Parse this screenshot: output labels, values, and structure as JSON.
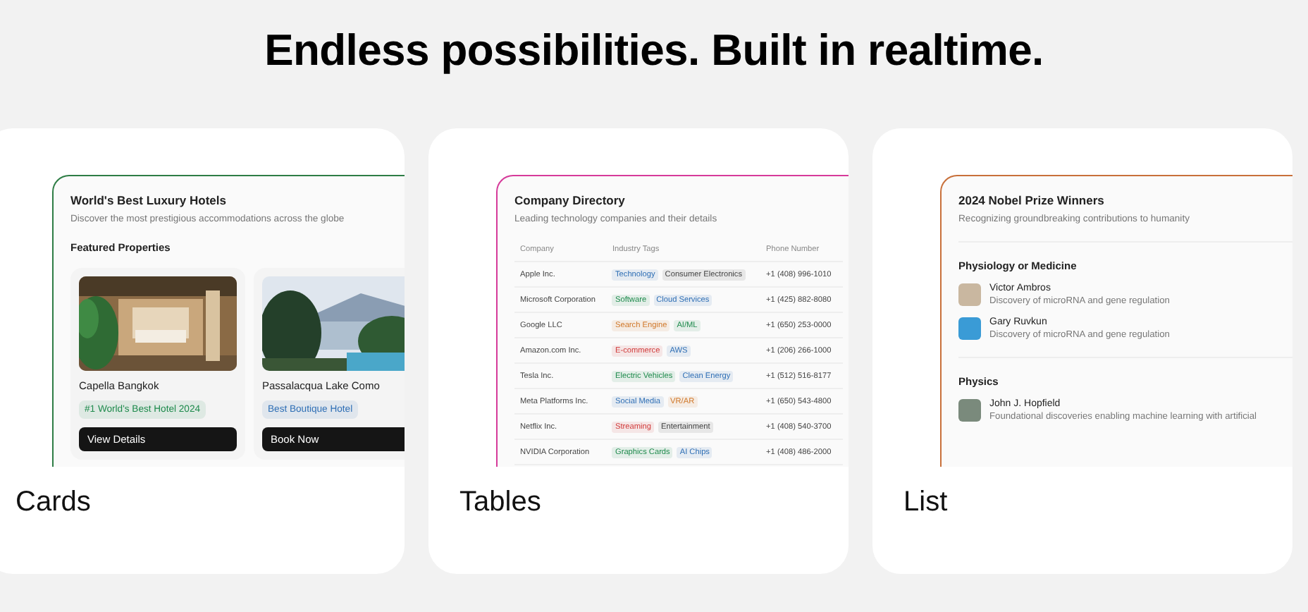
{
  "heading": "Endless possibilities. Built in realtime.",
  "cards": [
    {
      "kind": "cards",
      "label": "Cards",
      "color": "#2e7d45",
      "title": "World's Best Luxury Hotels",
      "subtitle": "Discover the most prestigious accommodations across the globe",
      "section": "Featured Properties",
      "items": [
        {
          "name": "Capella Bangkok",
          "badge": "#1 World's Best Hotel 2024",
          "color": "#1e8a4c",
          "button": "View Details"
        },
        {
          "name": "Passalacqua Lake Como",
          "badge": "Best Boutique Hotel",
          "color": "#2f6fb5",
          "button": "Book Now"
        }
      ]
    },
    {
      "kind": "table",
      "label": "Tables",
      "color": "#d63a9a",
      "title": "Company Directory",
      "subtitle": "Leading technology companies and their details",
      "columns": [
        "Company",
        "Industry Tags",
        "Phone Number"
      ],
      "rows": [
        {
          "company": "Apple Inc.",
          "tags": [
            {
              "label": "Technology",
              "color": "#2f6fb5"
            },
            {
              "label": "Consumer Electronics",
              "color": "#444444"
            }
          ],
          "phone": "+1 (408) 996-1010"
        },
        {
          "company": "Microsoft Corporation",
          "tags": [
            {
              "label": "Software",
              "color": "#1e8a4c"
            },
            {
              "label": "Cloud Services",
              "color": "#2f6fb5"
            }
          ],
          "phone": "+1 (425) 882-8080"
        },
        {
          "company": "Google LLC",
          "tags": [
            {
              "label": "Search Engine",
              "color": "#d0782a"
            },
            {
              "label": "AI/ML",
              "color": "#1e8a4c"
            }
          ],
          "phone": "+1 (650) 253-0000"
        },
        {
          "company": "Amazon.com Inc.",
          "tags": [
            {
              "label": "E-commerce",
              "color": "#d13b3b"
            },
            {
              "label": "AWS",
              "color": "#2f6fb5"
            }
          ],
          "phone": "+1 (206) 266-1000"
        },
        {
          "company": "Tesla Inc.",
          "tags": [
            {
              "label": "Electric Vehicles",
              "color": "#1e8a4c"
            },
            {
              "label": "Clean Energy",
              "color": "#2f6fb5"
            }
          ],
          "phone": "+1 (512) 516-8177"
        },
        {
          "company": "Meta Platforms Inc.",
          "tags": [
            {
              "label": "Social Media",
              "color": "#2f6fb5"
            },
            {
              "label": "VR/AR",
              "color": "#d0782a"
            }
          ],
          "phone": "+1 (650) 543-4800"
        },
        {
          "company": "Netflix Inc.",
          "tags": [
            {
              "label": "Streaming",
              "color": "#d13b3b"
            },
            {
              "label": "Entertainment",
              "color": "#444444"
            }
          ],
          "phone": "+1 (408) 540-3700"
        },
        {
          "company": "NVIDIA Corporation",
          "tags": [
            {
              "label": "Graphics Cards",
              "color": "#1e8a4c"
            },
            {
              "label": "AI Chips",
              "color": "#2f6fb5"
            }
          ],
          "phone": "+1 (408) 486-2000"
        }
      ]
    },
    {
      "kind": "list",
      "label": "List",
      "color": "#c8703a",
      "title": "2024 Nobel Prize Winners",
      "subtitle": "Recognizing groundbreaking contributions to humanity",
      "groups": [
        {
          "name": "Physiology or Medicine",
          "people": [
            {
              "name": "Victor Ambros",
              "note": "Discovery of microRNA and gene regulation"
            },
            {
              "name": "Gary Ruvkun",
              "note": "Discovery of microRNA and gene regulation"
            }
          ]
        },
        {
          "name": "Physics",
          "people": [
            {
              "name": "John J. Hopfield",
              "note": "Foundational discoveries enabling machine learning with artificial"
            }
          ]
        }
      ]
    }
  ]
}
